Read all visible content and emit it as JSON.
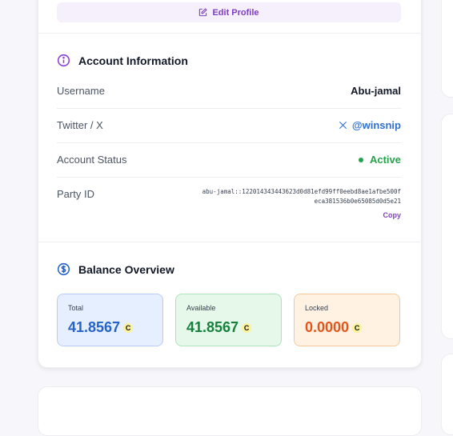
{
  "edit_profile": {
    "label": "Edit Profile",
    "icon": "edit-icon"
  },
  "account": {
    "title": "Account Information",
    "icon": "info-icon",
    "rows": {
      "username": {
        "label": "Username",
        "value": "Abu-jamal"
      },
      "twitter": {
        "label": "Twitter / X",
        "value": "@winsnip",
        "icon": "x-logo-icon"
      },
      "status": {
        "label": "Account Status",
        "value": "Active",
        "color": "#22a34a"
      },
      "party": {
        "label": "Party ID",
        "value": "abu-jamal::122014343443623d0d81efd99ff0eebd8ae1afbe500feca381536b0e65085d0d5e21",
        "copy_label": "Copy"
      }
    }
  },
  "balance": {
    "title": "Balance Overview",
    "icon": "dollar-circle-icon",
    "cards": [
      {
        "label": "Total",
        "value": "41.8567",
        "color": "#2563c9",
        "bg": "#e6efff",
        "border": "#b9cdf3",
        "symbol": "C"
      },
      {
        "label": "Available",
        "value": "41.8567",
        "color": "#16803c",
        "bg": "#e5f8ea",
        "border": "#aee3bd",
        "symbol": "C"
      },
      {
        "label": "Locked",
        "value": "0.0000",
        "color": "#e4561c",
        "bg": "#fff2e2",
        "border": "#f5c89b",
        "symbol": "C"
      }
    ]
  }
}
